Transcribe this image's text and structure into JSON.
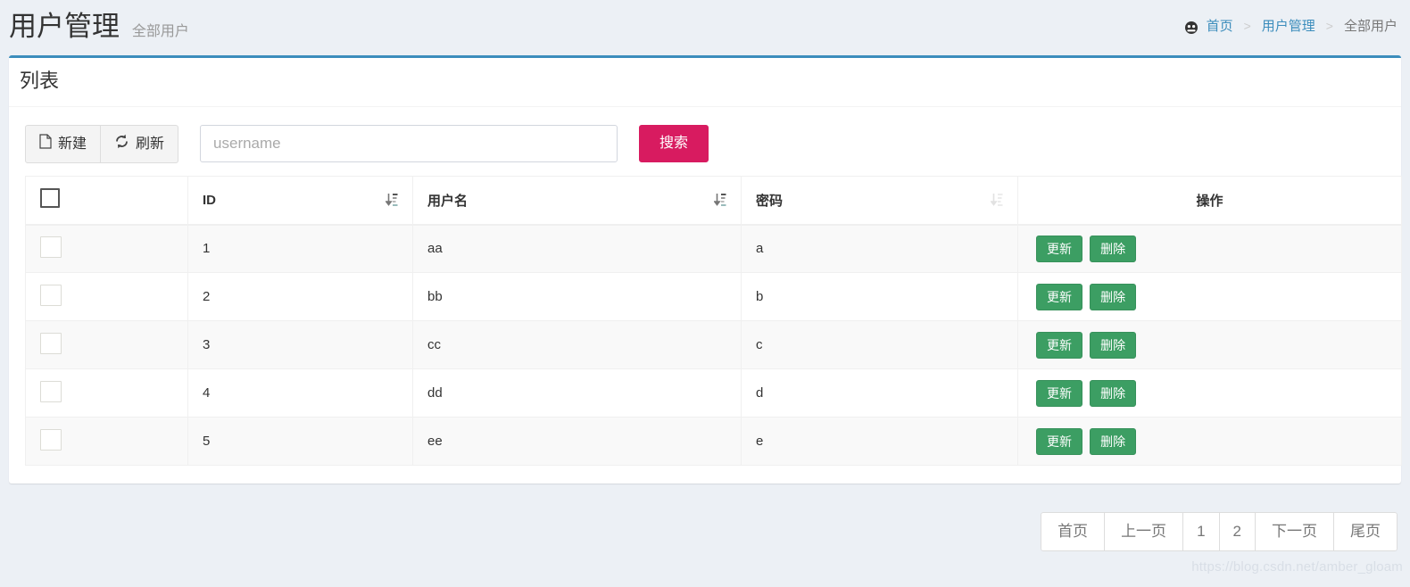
{
  "header": {
    "title": "用户管理",
    "subtitle": "全部用户",
    "breadcrumb": {
      "home_icon": "dashboard-icon",
      "items": [
        "首页",
        "用户管理",
        "全部用户"
      ],
      "separator": ">"
    }
  },
  "card": {
    "title": "列表",
    "accent_color": "#3c8dbc"
  },
  "toolbar": {
    "new_label": "新建",
    "new_icon": "file-icon",
    "refresh_label": "刷新",
    "refresh_icon": "refresh-icon",
    "search_placeholder": "username",
    "search_value": "",
    "search_button_label": "搜索",
    "search_button_color": "#d81b60"
  },
  "table": {
    "columns": [
      {
        "key": "check",
        "label": "",
        "sortable": false
      },
      {
        "key": "id",
        "label": "ID",
        "sortable": true,
        "sort_state": "active"
      },
      {
        "key": "username",
        "label": "用户名",
        "sortable": true,
        "sort_state": "active"
      },
      {
        "key": "password",
        "label": "密码",
        "sortable": true,
        "sort_state": "inactive"
      },
      {
        "key": "ops",
        "label": "操作",
        "sortable": false
      }
    ],
    "rows": [
      {
        "id": "1",
        "username": "aa",
        "password": "a"
      },
      {
        "id": "2",
        "username": "bb",
        "password": "b"
      },
      {
        "id": "3",
        "username": "cc",
        "password": "c"
      },
      {
        "id": "4",
        "username": "dd",
        "password": "d"
      },
      {
        "id": "5",
        "username": "ee",
        "password": "e"
      }
    ],
    "row_actions": {
      "update_label": "更新",
      "delete_label": "删除",
      "button_color": "#3c9e63"
    }
  },
  "pagination": {
    "items": [
      {
        "label": "首页",
        "type": "first"
      },
      {
        "label": "上一页",
        "type": "prev"
      },
      {
        "label": "1",
        "type": "num"
      },
      {
        "label": "2",
        "type": "num"
      },
      {
        "label": "下一页",
        "type": "next"
      },
      {
        "label": "尾页",
        "type": "last"
      }
    ]
  },
  "watermark": "https://blog.csdn.net/amber_gloam"
}
